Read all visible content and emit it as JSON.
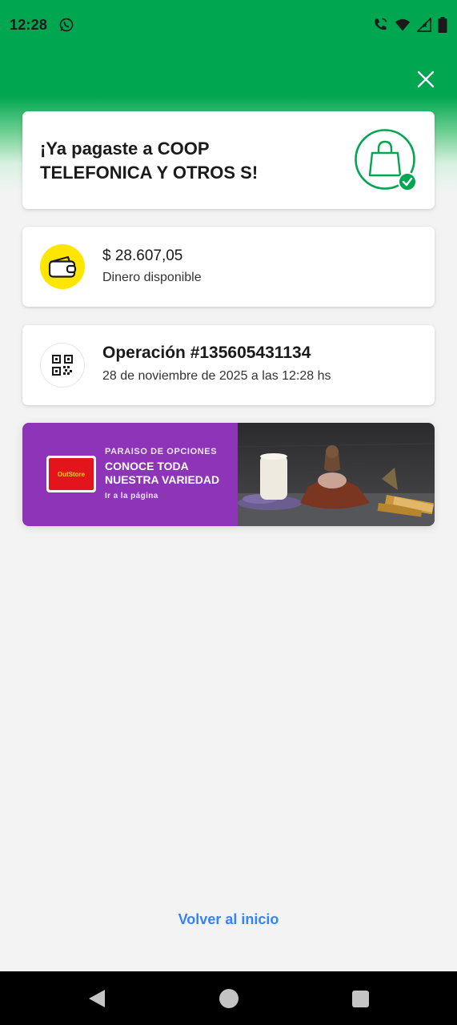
{
  "status_bar": {
    "time": "12:28",
    "icons": [
      "whatsapp-icon",
      "wifi-call-icon",
      "wifi-icon",
      "signal-icon",
      "battery-icon"
    ]
  },
  "header": {
    "close_icon": "close-icon",
    "color": "#00a650"
  },
  "success": {
    "title": "¡Ya pagaste a COOP TELEFONICA Y OTROS S!",
    "icon": "shopping-bag-check-icon"
  },
  "balance": {
    "amount": "$ 28.607,05",
    "label": "Dinero disponible",
    "icon": "wallet-icon"
  },
  "operation": {
    "title": "Operación #135605431134",
    "date": "28 de noviembre de 2025 a las 12:28 hs",
    "icon": "qr-code-icon"
  },
  "banner": {
    "logo_text": "OutStore",
    "kicker": "PARAISO DE OPCIONES",
    "headline": "CONOCE TODA NUESTRA VARIEDAD",
    "link": "Ir a la página",
    "background": "#8e34b8"
  },
  "footer": {
    "back_label": "Volver al inicio",
    "link_color": "#3483fa"
  },
  "nav": {
    "icons": [
      "back-triangle-icon",
      "home-circle-icon",
      "recents-square-icon"
    ]
  }
}
